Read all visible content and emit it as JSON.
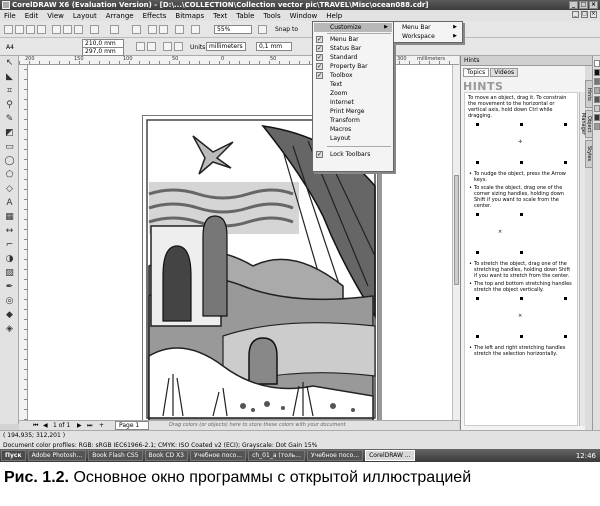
{
  "window": {
    "title": "CorelDRAW X6 (Evaluation Version) - [D:\\...\\COLLECTION\\Collection vector pic\\TRAVEL\\Misc\\ocean088.cdr]",
    "min": "_",
    "max": "□",
    "close": "×"
  },
  "menubar": {
    "items": [
      "File",
      "Edit",
      "View",
      "Layout",
      "Arrange",
      "Effects",
      "Bitmaps",
      "Text",
      "Table",
      "Tools",
      "Window",
      "Help"
    ]
  },
  "toolbar": {
    "zoom": "55%",
    "snap_to": "Snap to",
    "page_size": "A4",
    "width": "210,0 mm",
    "height": "297,0 mm",
    "units_label": "Units:",
    "units": "millimeters",
    "nudge": "0,1 mm",
    "dup_x": "5,0 mm",
    "dup_y": "5,0 mm"
  },
  "ruler": {
    "h_labels": [
      "200",
      "150",
      "100",
      "50",
      "0",
      "50",
      "100",
      "150",
      "200",
      "250",
      "300"
    ],
    "h_unit": "millimeters"
  },
  "customize_menu": {
    "label": "Customize",
    "items": [
      {
        "label": "Menu Bar",
        "checked": true
      },
      {
        "label": "Status Bar",
        "checked": true
      },
      {
        "label": "Standard",
        "checked": true
      },
      {
        "label": "Property Bar",
        "checked": true
      },
      {
        "label": "Toolbox",
        "checked": true
      },
      {
        "label": "Text",
        "checked": false
      },
      {
        "label": "Zoom",
        "checked": false
      },
      {
        "label": "Internet",
        "checked": false
      },
      {
        "label": "Print Merge",
        "checked": false
      },
      {
        "label": "Transform",
        "checked": false
      },
      {
        "label": "Macros",
        "checked": false
      },
      {
        "label": "Layout",
        "checked": false
      }
    ],
    "lock_label": "Lock Toolbars",
    "lock_checked": true
  },
  "submenu": {
    "items": [
      "Menu Bar",
      "Workspace"
    ]
  },
  "pagebar": {
    "counter": "1 of 1",
    "page_tab": "Page 1",
    "drop_hint": "Drag colors (or objects) here to store these colors with your document"
  },
  "statusbar": {
    "coords": "( 194,935; 312,201 )",
    "profiles": "Document color profiles: RGB: sRGB IEC61966-2.1; CMYK: ISO Coated v2 (ECI); Grayscale: Dot Gain 15%"
  },
  "docker": {
    "title": "Hints",
    "tabs": [
      "Topics",
      "Videos"
    ],
    "heading": "HINTS",
    "hint1": "To move an object, drag it. To constrain the movement to the horizontal or vertical axis, hold down Ctrl while dragging.",
    "hint2": "To nudge the object, press the Arrow keys.",
    "hint3": "To scale the object, drag one of the corner sizing handles, holding down Shift if you want to scale from the center.",
    "hint4": "To stretch the object, drag one of the stretching handles, holding down Shift if you want to stretch from the center.",
    "hint5": "The top and bottom stretching handles stretch the object vertically.",
    "hint6": "The left and right stretching handles stretch the selection horizontally.",
    "side_tabs": [
      "Hints",
      "Object Manager",
      "Styles"
    ]
  },
  "taskbar": {
    "start": "Пуск",
    "tasks": [
      "Adobe Photosh...",
      "Book Flash CS5",
      "Book CD X3",
      "Учебное посо...",
      "ch_01_a (толь...",
      "Учебное посо...",
      "CorelDRAW ..."
    ],
    "clock": "12:46"
  },
  "caption": {
    "label": "Рис. 1.2.",
    "text": "Основное окно программы с открытой иллюстрацией"
  }
}
